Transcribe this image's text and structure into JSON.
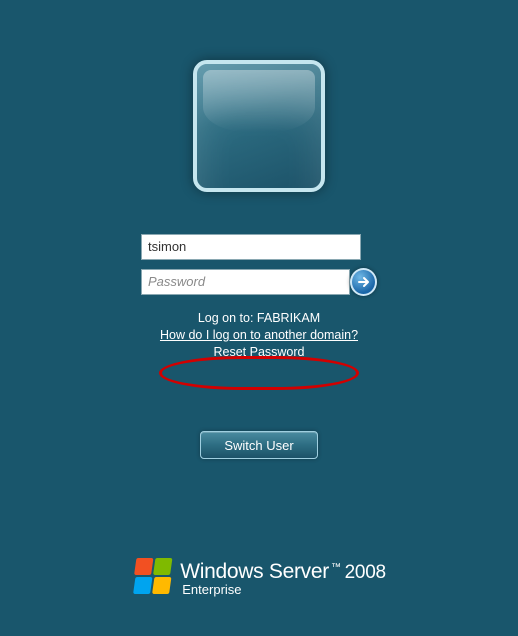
{
  "login": {
    "username_value": "tsimon",
    "password_placeholder": "Password",
    "logon_to_label": "Log on to: FABRIKAM",
    "other_domain_link": "How do I log on to another domain?",
    "reset_password_link": "Reset Password"
  },
  "actions": {
    "switch_user_label": "Switch User"
  },
  "branding": {
    "product": "Windows Server",
    "year": "2008",
    "edition": "Enterprise"
  }
}
